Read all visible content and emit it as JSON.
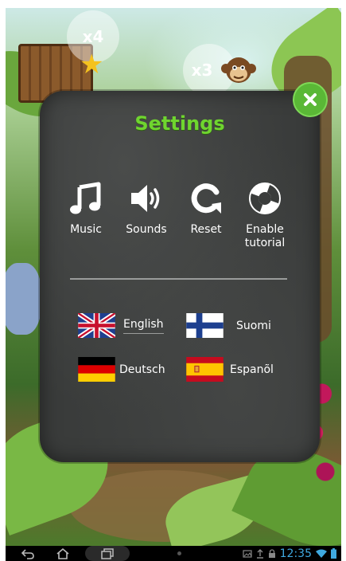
{
  "hud": {
    "bubble_left": "x4",
    "bubble_right": "x3"
  },
  "dialog": {
    "title": "Settings",
    "close_icon": "close-icon",
    "options": [
      {
        "icon": "music-note-icon",
        "label": "Music"
      },
      {
        "icon": "speaker-icon",
        "label": "Sounds"
      },
      {
        "icon": "reset-icon",
        "label": "Reset"
      },
      {
        "icon": "lifebuoy-icon",
        "label": "Enable tutorial"
      }
    ],
    "languages": [
      {
        "flag": "uk-flag-icon",
        "label": "English",
        "selected": true
      },
      {
        "flag": "finland-flag-icon",
        "label": "Suomi",
        "selected": false
      },
      {
        "flag": "germany-flag-icon",
        "label": "Deutsch",
        "selected": false
      },
      {
        "flag": "spain-flag-icon",
        "label": "Espanõl",
        "selected": false
      }
    ]
  },
  "status_bar": {
    "time": "12:35"
  },
  "colors": {
    "title_green": "#6fd52f",
    "close_green": "#5ab836",
    "chalkboard": "#3a3c3b",
    "clock_blue": "#3fa9e0"
  }
}
